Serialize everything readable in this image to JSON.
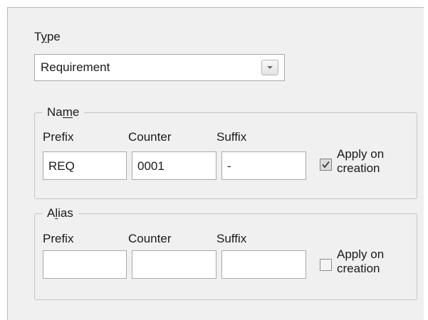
{
  "type_section": {
    "label_before": "T",
    "label_underlined": "y",
    "label_after": "pe",
    "selected_value": "Requirement",
    "dropdown_icon": "chevron-down-icon"
  },
  "name_group": {
    "legend_before": "Na",
    "legend_underlined": "m",
    "legend_after": "e",
    "prefix_label": "Prefix",
    "counter_label": "Counter",
    "suffix_label": "Suffix",
    "prefix_value": "REQ",
    "counter_value": "0001",
    "suffix_value": "-",
    "apply_label_line1": "Apply on",
    "apply_label_line2": "creation",
    "apply_checked": true
  },
  "alias_group": {
    "legend_before": "A",
    "legend_underlined": "l",
    "legend_after": "ias",
    "prefix_label": "Prefix",
    "counter_label": "Counter",
    "suffix_label": "Suffix",
    "prefix_value": "",
    "counter_value": "",
    "suffix_value": "",
    "apply_label_line1": "Apply on",
    "apply_label_line2": "creation",
    "apply_checked": false
  }
}
